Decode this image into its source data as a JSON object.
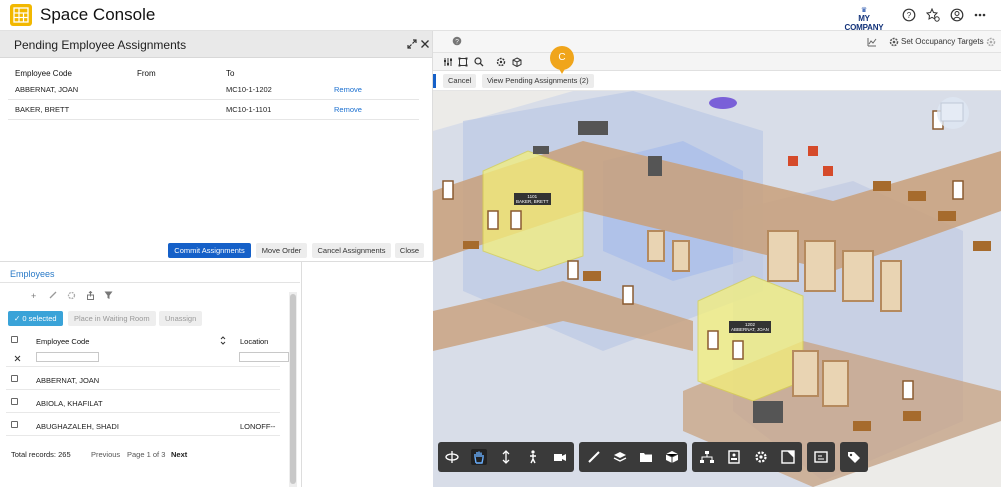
{
  "app": {
    "title": "Space Console",
    "company_name": "MY COMPANY",
    "company_sub": "INTERNATIONAL"
  },
  "top_icons": [
    "help-icon",
    "star-settings-icon",
    "user-icon",
    "more-icon"
  ],
  "pending": {
    "title": "Pending Employee Assignments",
    "columns": [
      "Employee Code",
      "From",
      "To"
    ],
    "rows": [
      {
        "employee": "ABBERNAT, JOAN",
        "from": "",
        "to": "MC10-1-1202",
        "action": "Remove"
      },
      {
        "employee": "BAKER, BRETT",
        "from": "",
        "to": "MC10-1-1101",
        "action": "Remove"
      }
    ],
    "buttons": {
      "commit": "Commit Assignments",
      "move_order": "Move Order",
      "cancel": "Cancel Assignments",
      "close": "Close"
    }
  },
  "employees": {
    "title": "Employees",
    "selected": "0 selected",
    "waiting_room": "Place in Waiting Room",
    "unassign": "Unassign",
    "columns": [
      "Employee Code",
      "Location"
    ],
    "rows": [
      {
        "name": "ABBERNAT, JOAN",
        "location": ""
      },
      {
        "name": "ABIOLA, KHAFILAT",
        "location": ""
      },
      {
        "name": "ABUGHAZALEH, SHADI",
        "location": "LONOFF--"
      }
    ],
    "total": "Total records: 265",
    "previous": "Previous",
    "page": "Page 1 of 3",
    "next": "Next"
  },
  "view": {
    "occupancy": "Set Occupancy Targets",
    "cancel": "Cancel",
    "view_pending": "View Pending Assignments (2)",
    "badge": "C",
    "room_1101_code": "1101",
    "room_1101_name": "BAKER, BRETT",
    "room_1202_code": "1202",
    "room_1202_name": "ABBERNAT, JOAN"
  },
  "colors": {
    "accent": "#1560c8",
    "badge": "#f0a51b",
    "highlight": "#f4f07a"
  }
}
